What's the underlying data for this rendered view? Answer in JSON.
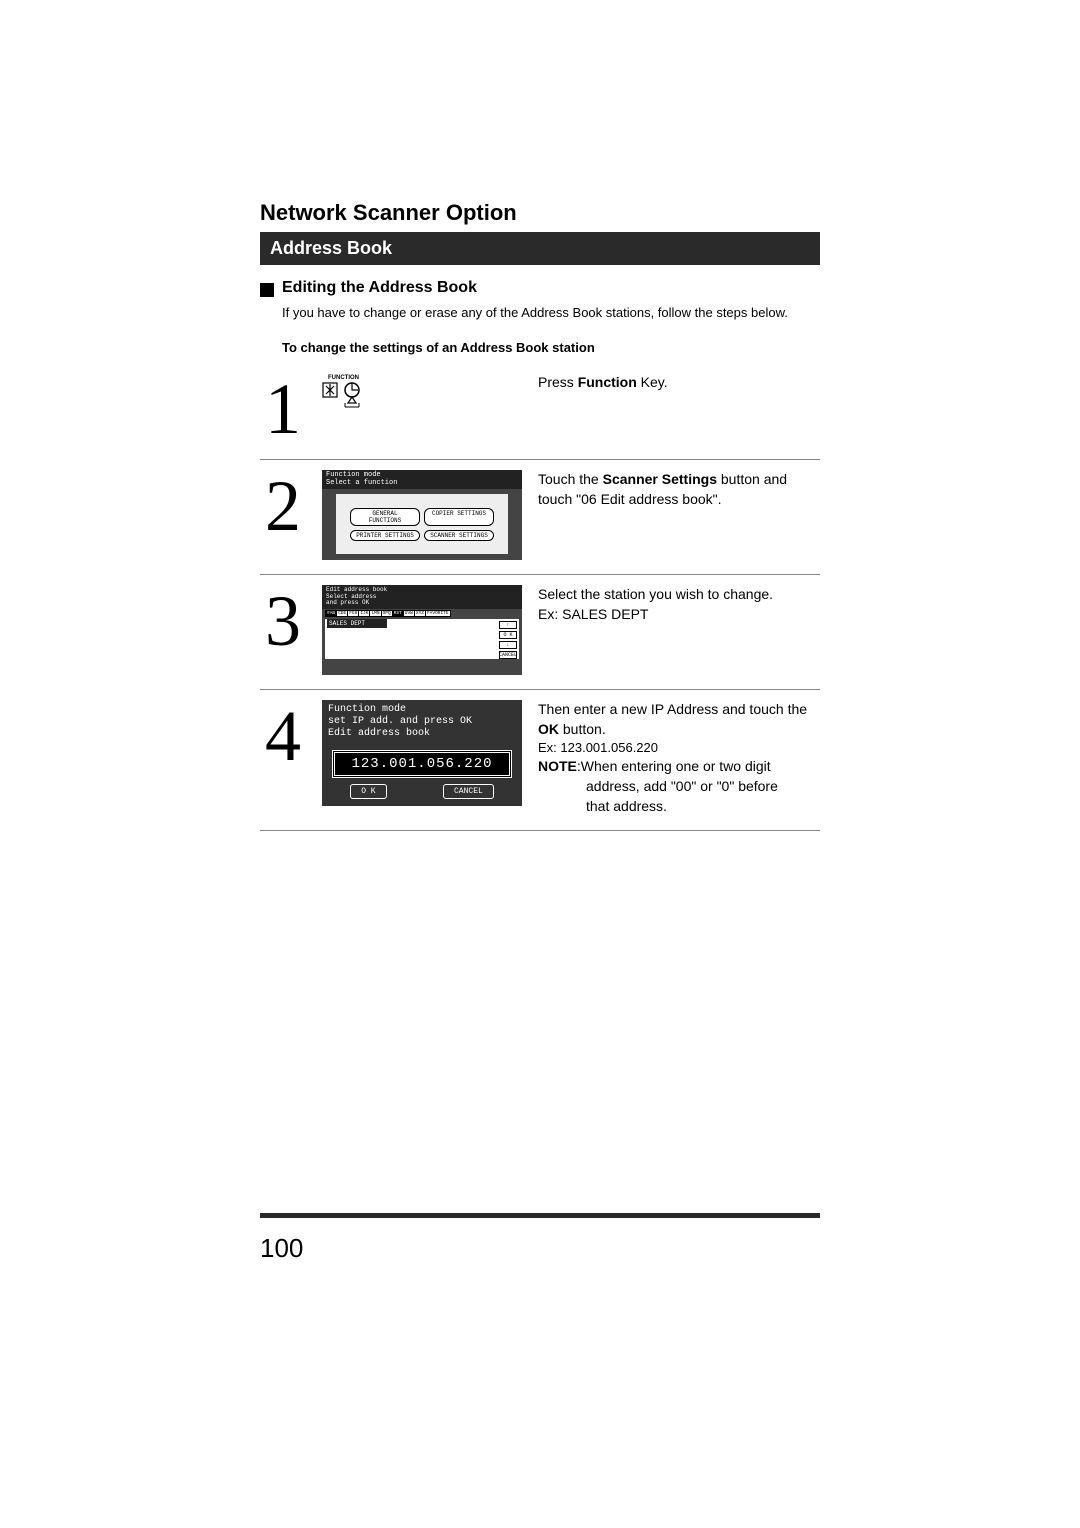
{
  "page_number": "100",
  "title": "Network Scanner Option",
  "banner": "Address Book",
  "subhead": "Editing the Address Book",
  "intro": "If you have to change or erase any of the Address Book stations, follow the steps below.",
  "change_heading": "To change the settings of an Address Book station",
  "step1": {
    "num": "1",
    "function_label": "FUNCTION",
    "text_pre": "Press ",
    "text_bold": "Function",
    "text_post": " Key."
  },
  "step2": {
    "num": "2",
    "lcd_line1": "Function mode",
    "lcd_line2": "Select a function",
    "btn_general": "GENERAL FUNCTIONS",
    "btn_copier": "COPIER SETTINGS",
    "btn_printer": "PRINTER SETTINGS",
    "btn_scanner": "SCANNER SETTINGS",
    "text_a": "Touch the ",
    "text_b": "Scanner Settings",
    "text_c": " button and touch \"06 Edit address book\"."
  },
  "step3": {
    "num": "3",
    "lcd_line1": "Edit address book",
    "lcd_line2": "Select address",
    "lcd_line3": "and press OK",
    "tabs": [
      "#AB",
      "CDE",
      "FGH",
      "IJK",
      "LMN",
      "OPQ",
      "RST",
      "UVW",
      "XYZ",
      "FAVORITE"
    ],
    "entry": "SALES DEPT",
    "ok": "O K",
    "cancel": "CANCEL",
    "up": "↑",
    "down": "↓",
    "text_a": "Select the station you wish to change.",
    "text_b": "Ex: SALES DEPT"
  },
  "step4": {
    "num": "4",
    "lcd_line1": "Function mode",
    "lcd_line2": "set IP add. and press OK",
    "lcd_line3": "Edit address book",
    "ip": "123.001.056.220",
    "ok": "O K",
    "cancel": "CANCEL",
    "text_a": "Then enter a new IP Address and touch the ",
    "text_b": "OK",
    "text_c": " button.",
    "ex_label": "Ex",
    "ex_val": ": 123.001.056.220",
    "note_label": "NOTE",
    "note_a": ":When entering one or two digit",
    "note_b": "address, add \"00\" or \"0\" before",
    "note_c": "that address."
  }
}
